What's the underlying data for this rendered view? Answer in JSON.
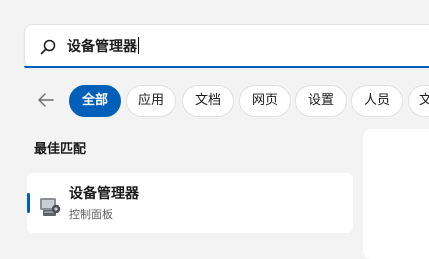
{
  "search": {
    "value": "设备管理器"
  },
  "filters": {
    "items": [
      {
        "label": "全部",
        "active": true
      },
      {
        "label": "应用",
        "active": false
      },
      {
        "label": "文档",
        "active": false
      },
      {
        "label": "网页",
        "active": false
      },
      {
        "label": "设置",
        "active": false
      },
      {
        "label": "人员",
        "active": false
      },
      {
        "label": "文",
        "active": false
      }
    ]
  },
  "best_match": {
    "heading": "最佳匹配",
    "title": "设备管理器",
    "subtitle": "控制面板",
    "icon": "device-manager-icon"
  },
  "colors": {
    "accent": "#005fb8",
    "background": "#f3f3f3"
  }
}
